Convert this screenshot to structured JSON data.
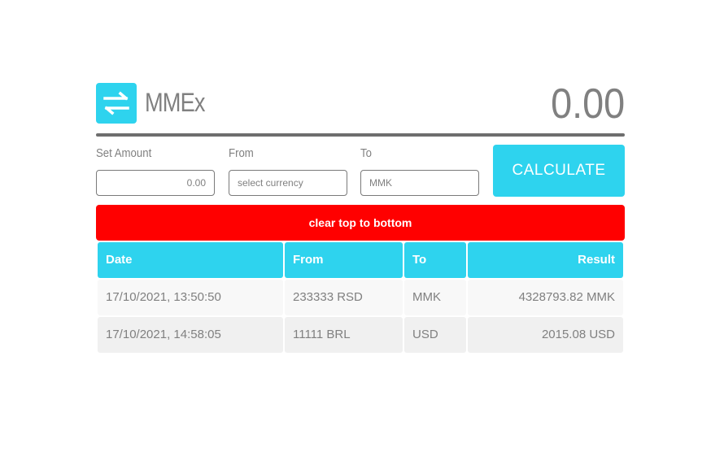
{
  "header": {
    "app_title": "MMEx",
    "total": "0.00",
    "logo_icon": "exchange-arrows-icon"
  },
  "form": {
    "amount_label": "Set Amount",
    "amount_value": "0.00",
    "from_label": "From",
    "from_placeholder": "select currency",
    "to_label": "To",
    "to_value": "MMK",
    "calculate_label": "CALCULATE"
  },
  "clear_label": "clear top to bottom",
  "table": {
    "headers": [
      "Date",
      "From",
      "To",
      "Result"
    ],
    "rows": [
      [
        "17/10/2021, 13:50:50",
        "233333 RSD",
        "MMK",
        "4328793.82 MMK"
      ],
      [
        "17/10/2021, 14:58:05",
        "11111 BRL",
        "USD",
        "2015.08 USD"
      ]
    ]
  },
  "colors": {
    "accent": "#2ed3ee",
    "danger": "#ff0000",
    "text": "#808080"
  }
}
